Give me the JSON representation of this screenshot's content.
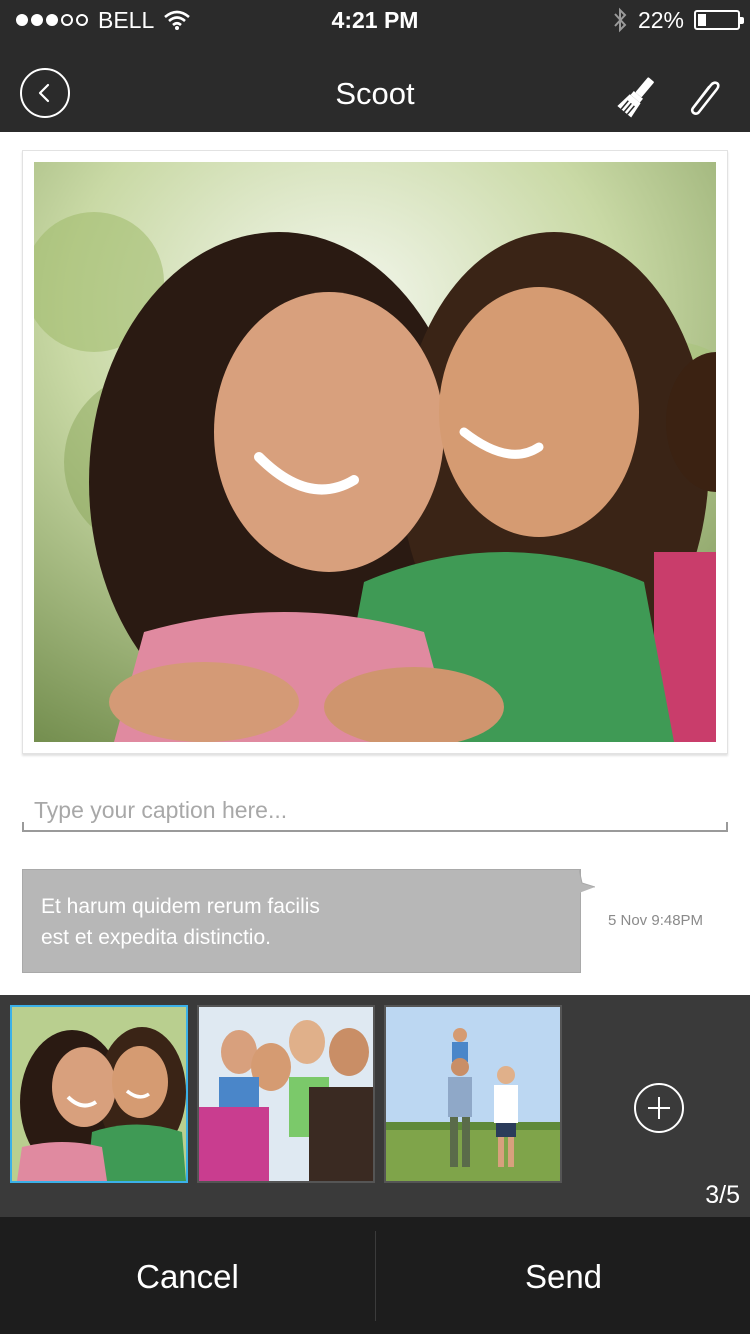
{
  "status_bar": {
    "carrier": "BELL",
    "time": "4:21 PM",
    "battery_text": "22%",
    "battery_level": 0.22,
    "signal_bars": 3,
    "signal_total": 5,
    "icons": [
      "wifi-icon",
      "bluetooth-icon",
      "battery-icon"
    ]
  },
  "nav": {
    "title": "Scoot",
    "back_icon": "chevron-left-icon",
    "actions": [
      "paintbrush-icon",
      "paperclip-icon"
    ]
  },
  "main_photo": {
    "subject": "photo-mother-daughter"
  },
  "caption": {
    "placeholder": "Type your caption here...",
    "value": ""
  },
  "message": {
    "lines": [
      "Et harum quidem rerum facilis",
      "est et expedita distinctio."
    ],
    "timestamp": "5 Nov 9:48PM"
  },
  "thumbnails": {
    "items": [
      "photo-mother-daughter",
      "photo-family-group",
      "photo-field-family"
    ],
    "selected_index": 0,
    "add_icon": "plus-icon",
    "count_text": "3/5"
  },
  "actions": {
    "cancel_label": "Cancel",
    "send_label": "Send"
  },
  "colors": {
    "bar_dark": "#2b2b2b",
    "bottom_bar": "#1d1d1d",
    "strip": "#3a3a3a",
    "selection": "#3bb0e8",
    "bubble": "#b7b7b7"
  }
}
